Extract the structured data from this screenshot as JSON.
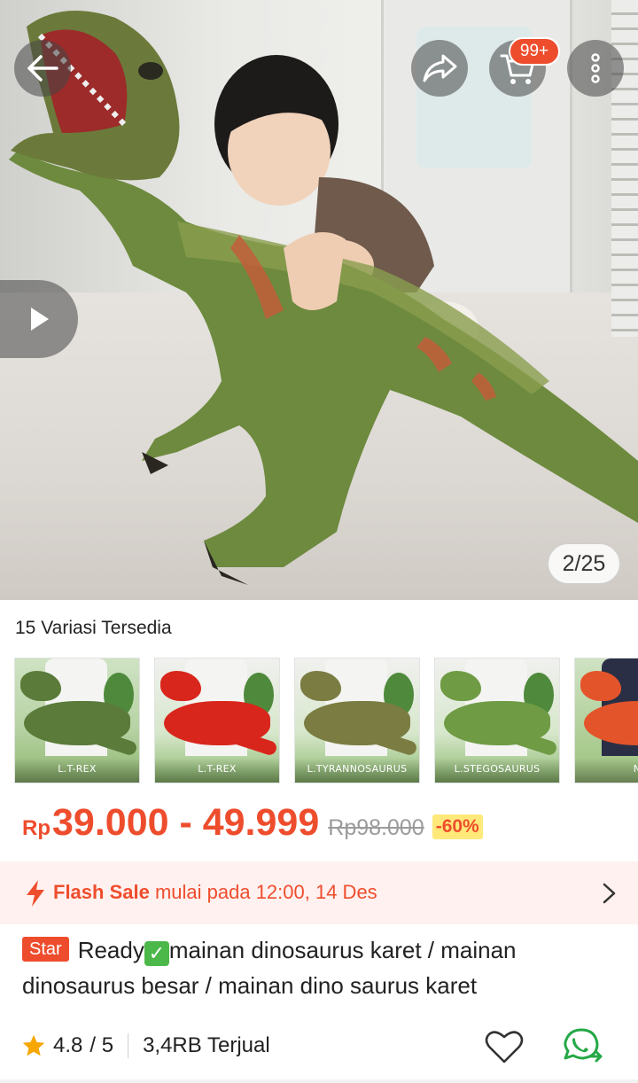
{
  "header": {
    "back_icon": "arrow-left-icon",
    "share_icon": "share-arrow-icon",
    "cart_icon": "shopping-cart-icon",
    "cart_badge": "99+",
    "more_icon": "more-vertical-icon"
  },
  "gallery": {
    "play_icon": "play-icon",
    "counter": "2/25"
  },
  "variants": {
    "count_label": "15 Variasi Tersedia",
    "items": [
      {
        "caption": "L.T-REX",
        "color": "#5a7b3a"
      },
      {
        "caption": "L.T-REX",
        "color": "#d9261c"
      },
      {
        "caption": "L.TYRANNOSAURUS",
        "color": "#7a7c42"
      },
      {
        "caption": "L.STEGOSAURUS",
        "color": "#6f9b45"
      },
      {
        "caption": "N",
        "color": "#e4542a"
      }
    ]
  },
  "price": {
    "currency": "Rp",
    "range": "39.000 - 49.999",
    "original": "Rp98.000",
    "discount": "-60%"
  },
  "flash_sale": {
    "label": "Flash Sale",
    "text": " mulai pada 12:00, 14 Des"
  },
  "product": {
    "badge": "Star",
    "title_prefix": "Ready",
    "title_rest": "mainan dinosaurus karet / mainan dinosaurus besar / mainan dino saurus karet"
  },
  "stats": {
    "rating": "4.8",
    "rating_max": "/ 5",
    "sold": "3,4RB Terjual"
  },
  "colors": {
    "accent": "#ee4d2d",
    "discount_bg": "#ffe97a",
    "flash_bg": "#fff1ef",
    "star": "#f6a700",
    "whatsapp": "#25a846"
  }
}
